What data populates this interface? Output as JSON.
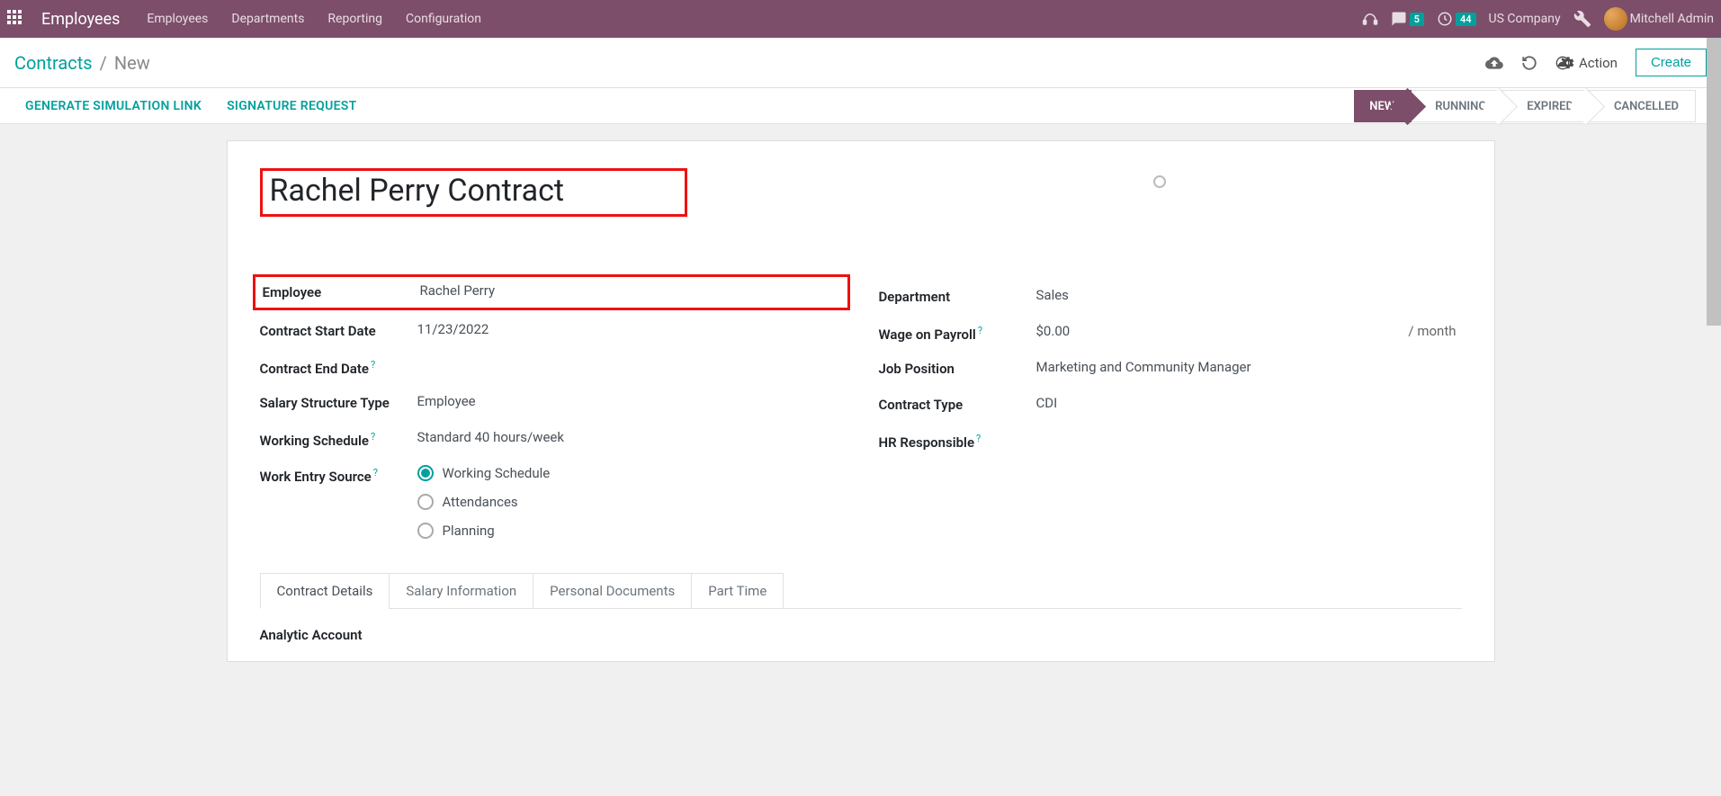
{
  "navbar": {
    "app_title": "Employees",
    "menu": [
      "Employees",
      "Departments",
      "Reporting",
      "Configuration"
    ],
    "messages_badge": "5",
    "activities_badge": "44",
    "company": "US Company",
    "user": "Mitchell Admin"
  },
  "breadcrumb": {
    "parent": "Contracts",
    "current": "New"
  },
  "control": {
    "action": "Action",
    "create": "Create"
  },
  "actions": {
    "simulate": "GENERATE SIMULATION LINK",
    "sign": "SIGNATURE REQUEST"
  },
  "status": [
    "NEW",
    "RUNNING",
    "EXPIRED",
    "CANCELLED"
  ],
  "title": "Rachel Perry Contract",
  "left_fields": {
    "employee": {
      "label": "Employee",
      "value": "Rachel Perry"
    },
    "start": {
      "label": "Contract Start Date",
      "value": "11/23/2022"
    },
    "end": {
      "label": "Contract End Date",
      "value": ""
    },
    "structure": {
      "label": "Salary Structure Type",
      "value": "Employee"
    },
    "schedule": {
      "label": "Working Schedule",
      "value": "Standard 40 hours/week"
    },
    "source": {
      "label": "Work Entry Source",
      "options": [
        "Working Schedule",
        "Attendances",
        "Planning"
      ]
    }
  },
  "right_fields": {
    "department": {
      "label": "Department",
      "value": "Sales"
    },
    "wage": {
      "label": "Wage on Payroll",
      "value": "$0.00",
      "suffix": "/ month"
    },
    "position": {
      "label": "Job Position",
      "value": "Marketing and Community Manager"
    },
    "type": {
      "label": "Contract Type",
      "value": "CDI"
    },
    "hr": {
      "label": "HR Responsible",
      "value": ""
    }
  },
  "tabs": [
    "Contract Details",
    "Salary Information",
    "Personal Documents",
    "Part Time"
  ],
  "tab_content": {
    "analytic": "Analytic Account"
  }
}
